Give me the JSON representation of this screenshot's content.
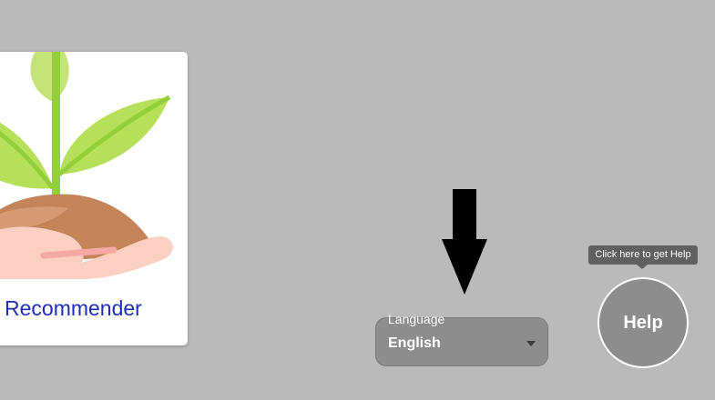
{
  "card": {
    "title": "Recommender",
    "illustration": "plant-in-hand-icon"
  },
  "arrow": {
    "icon": "down-arrow-icon",
    "color": "#000000"
  },
  "language": {
    "label": "Language",
    "value": "English",
    "caret_icon": "caret-down-icon"
  },
  "help": {
    "tooltip": "Click here to get Help",
    "label": "Help"
  },
  "colors": {
    "background": "#bababa",
    "card_title": "#1f2db5",
    "leaf_light": "#b6e05a",
    "stem": "#93cf3a",
    "soil": "#c4845a",
    "hand": "#fbd0c2"
  }
}
